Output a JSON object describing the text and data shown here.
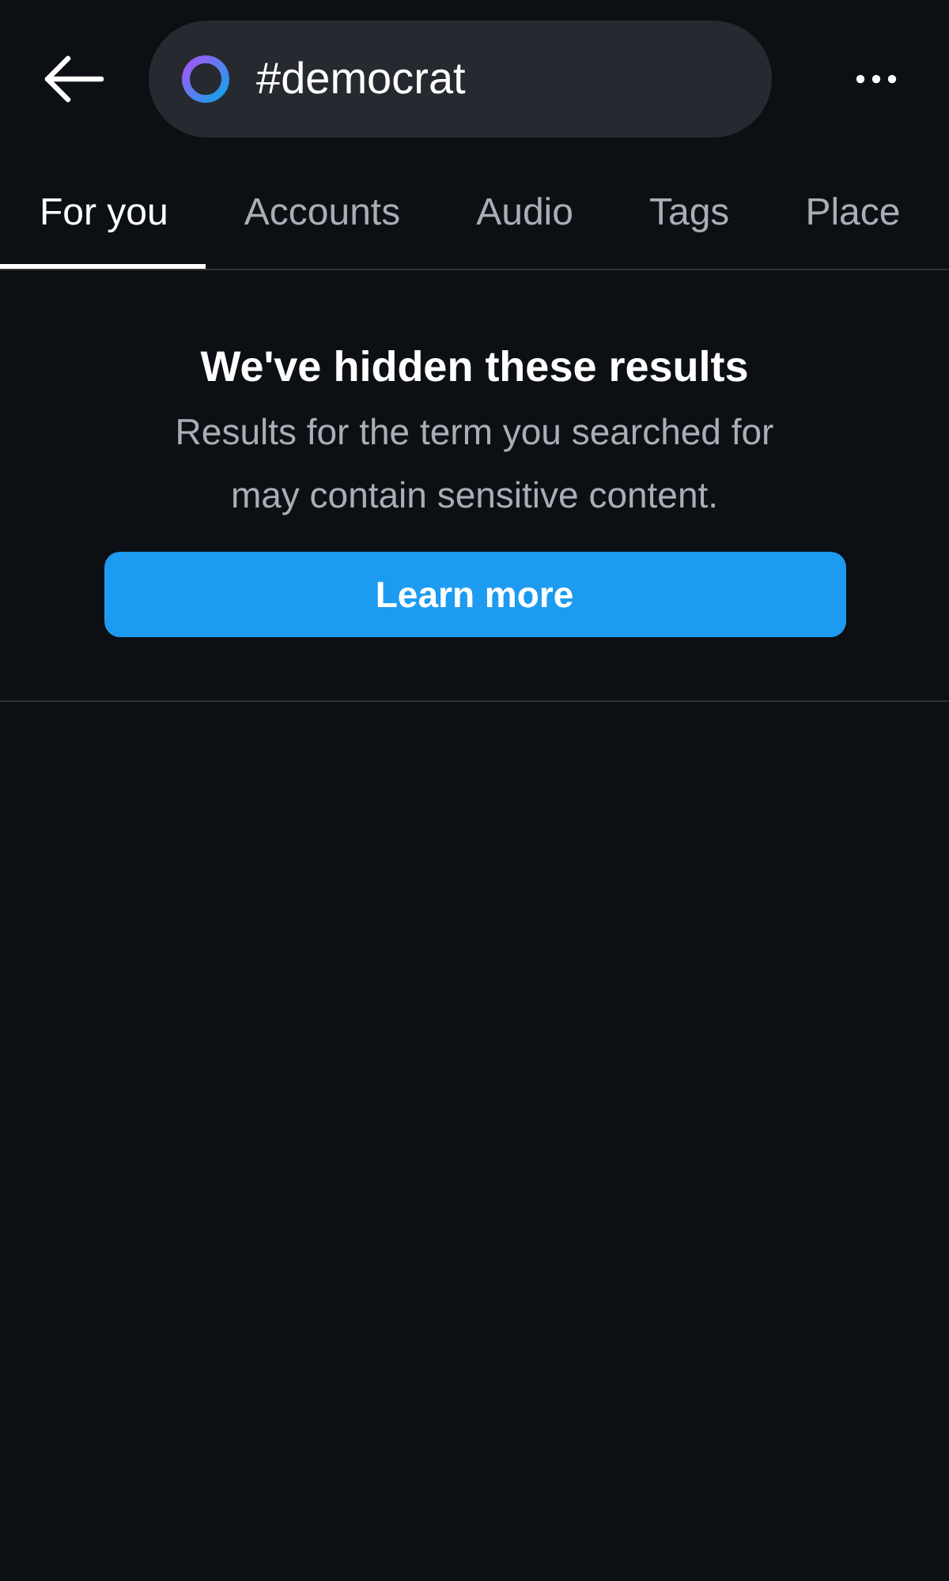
{
  "search": {
    "value": "#democrat"
  },
  "tabs": [
    {
      "label": "For you",
      "selected": true
    },
    {
      "label": "Accounts",
      "selected": false
    },
    {
      "label": "Audio",
      "selected": false
    },
    {
      "label": "Tags",
      "selected": false
    },
    {
      "label": "Place",
      "selected": false
    }
  ],
  "notice": {
    "title": "We've hidden these results",
    "body": "Results for the term you searched for may contain sensitive content.",
    "button": "Learn more"
  }
}
